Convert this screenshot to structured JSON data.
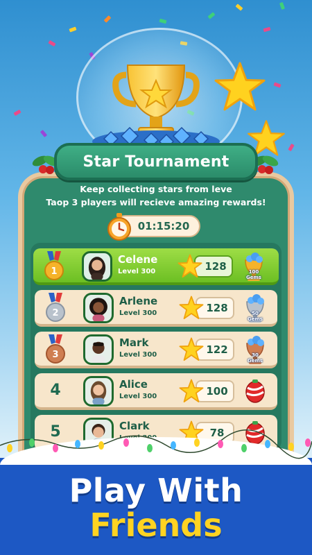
{
  "header": {
    "title": "Star Tournament",
    "subtitle_line1": "Keep collecting stars from leve",
    "subtitle_line2": "Taop 3 players will recieve amazing rewards!",
    "timer": "01:15:20"
  },
  "leaderboard": [
    {
      "rank": "1",
      "name": "Celene",
      "level": "Level 300",
      "score": "128",
      "reward": "100\nGems",
      "reward_type": "gold-trophy-gems",
      "medal_color": "#f5b32a",
      "highlighted": true
    },
    {
      "rank": "2",
      "name": "Arlene",
      "level": "Level 300",
      "score": "128",
      "reward": "50\nGems",
      "reward_type": "silver-trophy-gems",
      "medal_color": "#b9c2cc",
      "highlighted": false
    },
    {
      "rank": "3",
      "name": "Mark",
      "level": "Level 300",
      "score": "122",
      "reward": "30\nGems",
      "reward_type": "bronze-trophy-gems",
      "medal_color": "#cf7e52",
      "highlighted": false
    },
    {
      "rank": "4",
      "name": "Alice",
      "level": "Level 300",
      "score": "100",
      "reward": "",
      "reward_type": "candy-orb",
      "highlighted": false
    },
    {
      "rank": "5",
      "name": "Clark",
      "level": "Level 300",
      "score": "78",
      "reward": "",
      "reward_type": "candy-orb",
      "highlighted": false
    }
  ],
  "promo": {
    "line1": "Play With",
    "line2": "Friends"
  },
  "colors": {
    "panel_green": "#2f8a6d",
    "highlight_green": "#7fcc2f",
    "footer_blue": "#1d58c4",
    "accent_yellow": "#ffd322"
  },
  "icons": [
    "trophy-icon",
    "star-icon",
    "stopwatch-icon",
    "medal-icon",
    "gem-trophy-icon",
    "candy-orb-icon",
    "holly-icon"
  ]
}
